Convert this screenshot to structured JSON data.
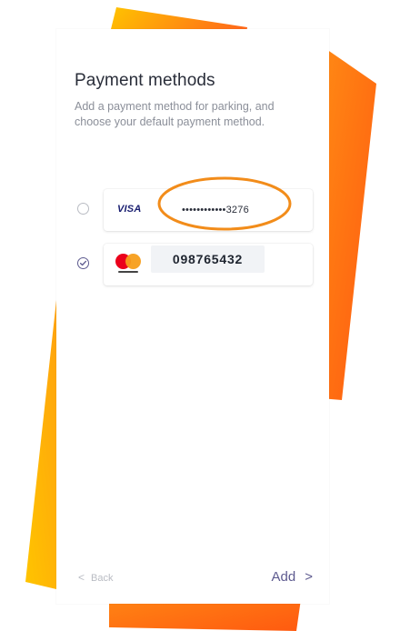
{
  "screen": {
    "title": "Payment methods",
    "subtitle": "Add a payment method for parking, and choose your default payment method."
  },
  "payment_methods": [
    {
      "brand": "VISA",
      "number": "••••••••••••3276",
      "selected": false,
      "annotated": true
    },
    {
      "brand": "mastercard-icon",
      "number": "098765432",
      "selected": true
    }
  ],
  "footer": {
    "back_label": "Back",
    "back_icon": "chevron-left-icon",
    "add_label": "Add",
    "add_icon": "chevron-right-icon"
  },
  "colors": {
    "accent": "#5d5a8f",
    "annotation": "#f28c1a",
    "backdrop_orange": "#ff6a1a",
    "backdrop_yellow": "#ffc400"
  }
}
